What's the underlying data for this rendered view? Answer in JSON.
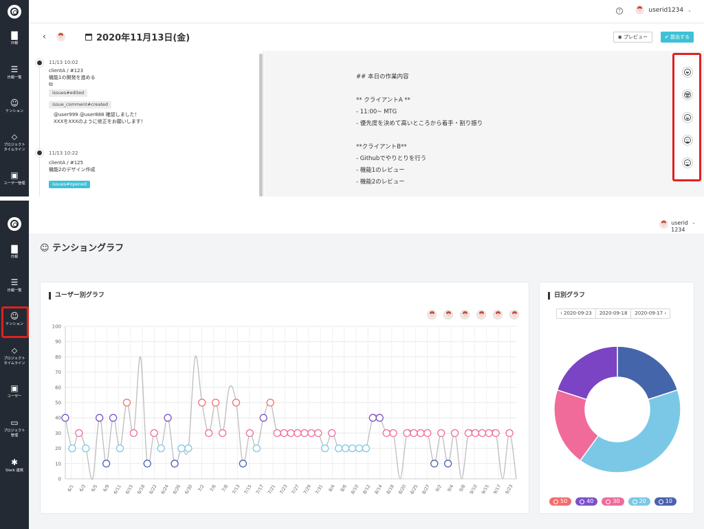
{
  "frame1": {
    "user": {
      "name": "userid1234"
    },
    "date_title": "2020年11月13日(金)",
    "buttons": {
      "preview": "プレビュー",
      "submit": "提出する"
    },
    "sidebar": [
      "日報",
      "日報一覧",
      "テンション",
      "プロジェクト\nタイムライン",
      "ユーザー管理"
    ],
    "events": [
      {
        "time": "11/13 10:02",
        "issue": "clientA / #123",
        "text": "機能1の開発を進める",
        "tags": [
          "issues#edited",
          "issue_comment#created"
        ],
        "comment1": "@user999 @user888 確認しました！",
        "comment2": "XXXをXXXのように修正をお願いします！"
      },
      {
        "time": "11/13 10:22",
        "issue": "clientA / #125",
        "text": "機能2のデザイン作成",
        "tags": [
          "issues#opened"
        ]
      }
    ],
    "markdown": "## 本日の作業内容\n\n** クライアントA **\n- 11:00~ MTG\n- 優先度を決めて高いところから着手・割り振り\n\n**クライアントB**\n- Githubでやりとりを行う\n- 機能1のレビュー\n- 機能2のレビュー",
    "tension_icons": [
      "grin-face-icon",
      "sunglasses-face-icon",
      "smile-face-icon",
      "neutral-face-icon",
      "sad-face-icon"
    ]
  },
  "frame2": {
    "user": {
      "name": "userid1234"
    },
    "page_title": "テンショングラフ",
    "sidebar": [
      "日報",
      "日報一覧",
      "テンション",
      "プロジェクト\nタイムライン",
      "ユーザー",
      "プロジェクト\n管理",
      "Slack 連携"
    ],
    "user_chart_title": "ユーザー別グラフ",
    "daily_chart_title": "日別グラフ",
    "dates": [
      "2020-09-23",
      "2020-09-18",
      "2020-09-17"
    ],
    "colors": {
      "50": "#f26d6d",
      "40": "#7b52c9",
      "30": "#f06a9a",
      "20": "#7bc8e6",
      "10": "#4a62b0"
    }
  },
  "chart_data": [
    {
      "type": "line",
      "title": "ユーザー別グラフ",
      "ylim": [
        0,
        100
      ],
      "yticks": [
        0,
        10,
        20,
        30,
        40,
        50,
        60,
        70,
        80,
        90,
        100
      ],
      "grid": true,
      "xticks": [
        "6/1",
        "6/3",
        "6/5",
        "6/9",
        "6/11",
        "6/15",
        "6/18",
        "6/22",
        "6/24",
        "6/26",
        "6/30",
        "7/2",
        "7/6",
        "7/8",
        "7/13",
        "7/15",
        "7/17",
        "7/21",
        "7/23",
        "7/27",
        "7/29",
        "7/31",
        "8/4",
        "8/6",
        "8/10",
        "8/12",
        "8/14",
        "8/18",
        "8/20",
        "8/25",
        "8/27",
        "9/2",
        "9/4",
        "9/8",
        "9/10",
        "9/15",
        "9/17",
        "9/23"
      ],
      "values": [
        40,
        20,
        30,
        20,
        0,
        40,
        10,
        40,
        20,
        50,
        30,
        80,
        10,
        30,
        20,
        40,
        10,
        20,
        20,
        80,
        50,
        30,
        50,
        30,
        60,
        50,
        10,
        30,
        20,
        40,
        50,
        30,
        30,
        30,
        30,
        30,
        30,
        30,
        20,
        30,
        20,
        20,
        20,
        20,
        20,
        40,
        40,
        30,
        30,
        0,
        30,
        30,
        30,
        30,
        10,
        30,
        10,
        30,
        0,
        30,
        30,
        30,
        30,
        30,
        0,
        30,
        0
      ],
      "marker_levels": [
        10,
        20,
        30,
        40,
        50
      ]
    },
    {
      "type": "pie",
      "title": "日別グラフ",
      "donut": true,
      "slices": [
        {
          "label": "10",
          "value": 20,
          "color": "#4565aa"
        },
        {
          "label": "20",
          "value": 40,
          "color": "#7bc8e6"
        },
        {
          "label": "30",
          "value": 20,
          "color": "#f06a9a"
        },
        {
          "label": "40",
          "value": 20,
          "color": "#7b44c4"
        }
      ],
      "legend": [
        {
          "label": "50",
          "color": "#f26d6d"
        },
        {
          "label": "40",
          "color": "#7b52c9"
        },
        {
          "label": "30",
          "color": "#f06a9a"
        },
        {
          "label": "20",
          "color": "#7bc8e6"
        },
        {
          "label": "10",
          "color": "#4a62b0"
        }
      ]
    }
  ]
}
